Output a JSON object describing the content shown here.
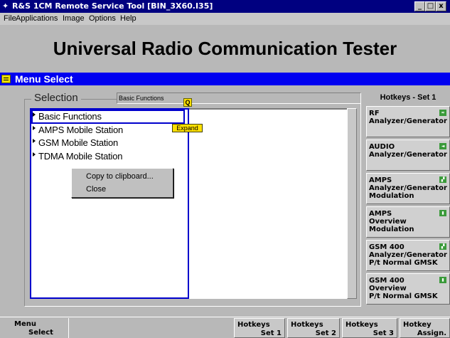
{
  "window": {
    "title": "R&S 1CM Remote Service Tool [BIN_3X60.I35]",
    "icon": "rs-app-icon",
    "buttons": {
      "minimize": "_",
      "maximize": "□",
      "close": "x"
    }
  },
  "menubar": {
    "items": [
      "File",
      "Applications",
      "Image",
      "Options",
      "Help"
    ]
  },
  "header": {
    "title": "Universal Radio Communication Tester"
  },
  "menu_select": {
    "label": "Menu Select"
  },
  "selection": {
    "legend": "Selection",
    "current": "Basic Functions",
    "items": [
      {
        "label": "Basic Functions",
        "selected": true
      },
      {
        "label": "AMPS Mobile Station",
        "selected": false
      },
      {
        "label": "GSM Mobile Station",
        "selected": false
      },
      {
        "label": "TDMA Mobile Station",
        "selected": false
      }
    ],
    "q_marker": "Q",
    "expand_tooltip": "Expand"
  },
  "context_menu": {
    "items": [
      "Copy to clipboard...",
      "Close"
    ]
  },
  "hotkeys": {
    "title": "Hotkeys - Set 1",
    "buttons": [
      {
        "lines": [
          "RF",
          "Analyzer/Generator"
        ],
        "icon": "rf-icon"
      },
      {
        "lines": [
          "AUDIO",
          "Analyzer/Generator"
        ],
        "icon": "audio-icon"
      },
      {
        "lines": [
          "AMPS",
          "Analyzer/Generator",
          "Modulation"
        ],
        "icon": "amps-mod-icon"
      },
      {
        "lines": [
          "AMPS",
          "Overview",
          "Modulation"
        ],
        "icon": "amps-overview-icon"
      },
      {
        "lines": [
          "GSM 400",
          "Analyzer/Generator",
          "P/t Normal GMSK"
        ],
        "icon": "gsm-gen-icon"
      },
      {
        "lines": [
          "GSM 400",
          "Overview",
          "P/t Normal GMSK"
        ],
        "icon": "gsm-overview-icon"
      }
    ]
  },
  "softkeys": {
    "menu_select": {
      "line1": "Menu",
      "line2": "Select"
    },
    "hotkeys_set1": {
      "line1": "Hotkeys",
      "line2": "Set 1"
    },
    "hotkeys_set2": {
      "line1": "Hotkeys",
      "line2": "Set 2"
    },
    "hotkeys_set3": {
      "line1": "Hotkeys",
      "line2": "Set 3"
    },
    "hotkey_assign": {
      "line1": "Hotkey",
      "line2": "Assign."
    }
  },
  "colors": {
    "title_bar": "#000080",
    "menu_select_bar": "#0000f0",
    "selection_border": "#0000cc",
    "tooltip": "#ffe000"
  }
}
